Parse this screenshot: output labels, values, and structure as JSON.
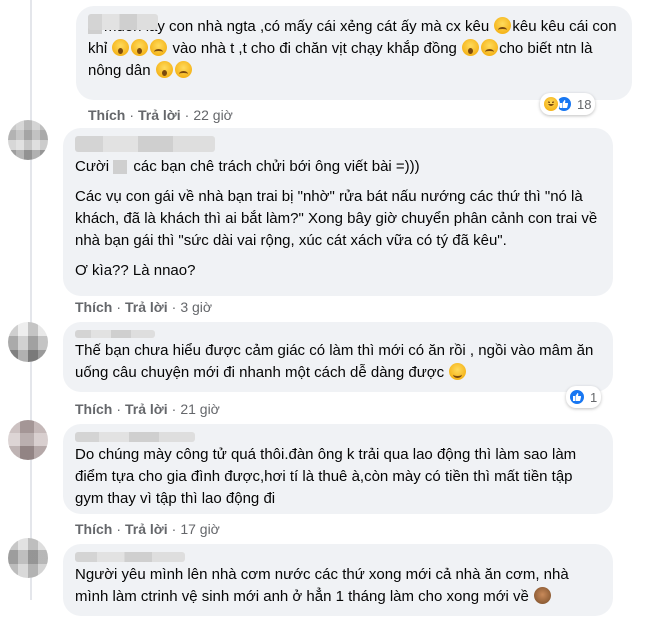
{
  "comments": [
    {
      "id": "c1",
      "paragraphs": [
        "muốn lấy con nhà ngta ,có mấy cái xẻng cát ấy mà cx kêu",
        "kêu kêu cái con khỉ",
        "vào nhà t ,t cho đi chăn vịt chạy khắp đồng",
        "cho biết ntn là nông dân"
      ],
      "actions": {
        "like": "Thích",
        "reply": "Trả lời",
        "time": "22 giờ"
      },
      "reaction_count": "18"
    },
    {
      "id": "c2",
      "p1": "Cười",
      "p1b": "các bạn chê trách chửi bới ông viết bài =)))",
      "p2": "Các vụ con gái về nhà bạn trai bị \"nhờ\" rửa bát nấu nướng các thứ thì \"nó là khách, đã là khách thì ai bắt làm?\" Xong bây giờ chuyển phân cảnh con trai về nhà bạn gái thì \"sức dài vai rộng, xúc cát xách vữa có tý đã kêu\".",
      "p3": "Ơ kìa?? Là nnao?",
      "actions": {
        "like": "Thích",
        "reply": "Trả lời",
        "time": "3 giờ"
      }
    },
    {
      "id": "c3",
      "text": "Thế bạn chưa hiểu được cảm giác có làm thì mới có ăn rồi , ngồi vào mâm ăn uống câu chuyện mới đi nhanh một cách dễ dàng được",
      "actions": {
        "like": "Thích",
        "reply": "Trả lời",
        "time": "21 giờ"
      },
      "reaction_count": "1"
    },
    {
      "id": "c4",
      "text": "Do chúng mày công tử quá thôi.đàn ông k trải qua lao động thì làm sao làm điểm tựa cho gia đình được,hơi tí là thuê à,còn mày có tiền thì mất tiền tập gym thay vì tập thì lao động đi",
      "actions": {
        "like": "Thích",
        "reply": "Trả lời",
        "time": "17 giờ"
      }
    },
    {
      "id": "c5",
      "text": "Người yêu mình lên nhà cơm nước các thứ xong mới cả nhà ăn cơm, nhà mình làm ctrinh vệ sinh mới anh ở hẳn 1 tháng làm cho xong mới về"
    }
  ],
  "separator": "·",
  "colors": {
    "bubble": "#f0f2f5",
    "meta": "#65676b",
    "like_blue": "#1877f2"
  },
  "icons": [
    "haha-reaction-icon",
    "like-reaction-icon",
    "shocked-emoji-icon",
    "sad-emoji-icon",
    "smile-emoji-icon",
    "monkey-see-no-evil-icon"
  ]
}
